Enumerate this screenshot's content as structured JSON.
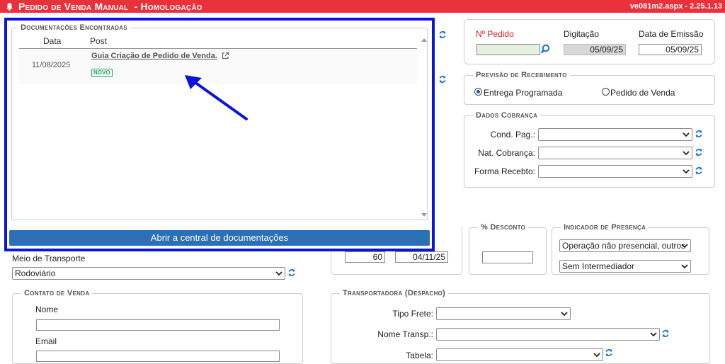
{
  "header": {
    "title": "Pedido de Venda Manual",
    "env": "- Homologação",
    "version": "ve081m2.aspx - 2.25.1.13"
  },
  "pedido": {
    "numero_label": "Nº Pedido",
    "digitacao_label": "Digitação",
    "digitacao_value": "05/09/25",
    "emissao_label": "Data de Emissão",
    "emissao_value": "05/09/25"
  },
  "previsao": {
    "legend": "Previsão de Recebimento",
    "opt1": "Entrega Programada",
    "opt2": "Pedido de Venda"
  },
  "cobranca": {
    "legend": "Dados Cobrança",
    "cond_label": "Cond. Pag.:",
    "nat_label": "Nat. Cobrança:",
    "forma_label": "Forma Recebto:"
  },
  "desconto": {
    "legend": "% Desconto"
  },
  "presenca": {
    "legend": "Indicador de Presença",
    "sel1": "Operação não presencial, outros",
    "sel2": "Sem Intermediador"
  },
  "prazo": {
    "dias": "60",
    "data": "04/11/25"
  },
  "transporte": {
    "label": "Meio de Transporte",
    "value": "Rodoviário"
  },
  "contato": {
    "legend": "Contato de Venda",
    "nome_label": "Nome",
    "email_label": "Email"
  },
  "transportadora": {
    "legend": "Transportadora (Despacho)",
    "frete_label": "Tipo Frete:",
    "nome_label": "Nome Transp.:",
    "tabela_label": "Tabela:"
  },
  "docs": {
    "legend": "Documentações Encontradas",
    "col_data": "Data",
    "col_post": "Post",
    "row_date": "11/08/2025",
    "row_post": "Guia Criação de Pedido de Venda.",
    "row_badge": "NOVO",
    "button": "Abrir a central de documentações"
  },
  "colors": {
    "brand": "#e8313a",
    "highlight": "#0a15dc",
    "button": "#2b6fb5",
    "badge": "#21a366",
    "refresh": "#1a6fd1"
  },
  "icons": [
    "bell-icon",
    "search-icon",
    "refresh-icon",
    "external-link-icon",
    "arrow-annotation-icon"
  ]
}
